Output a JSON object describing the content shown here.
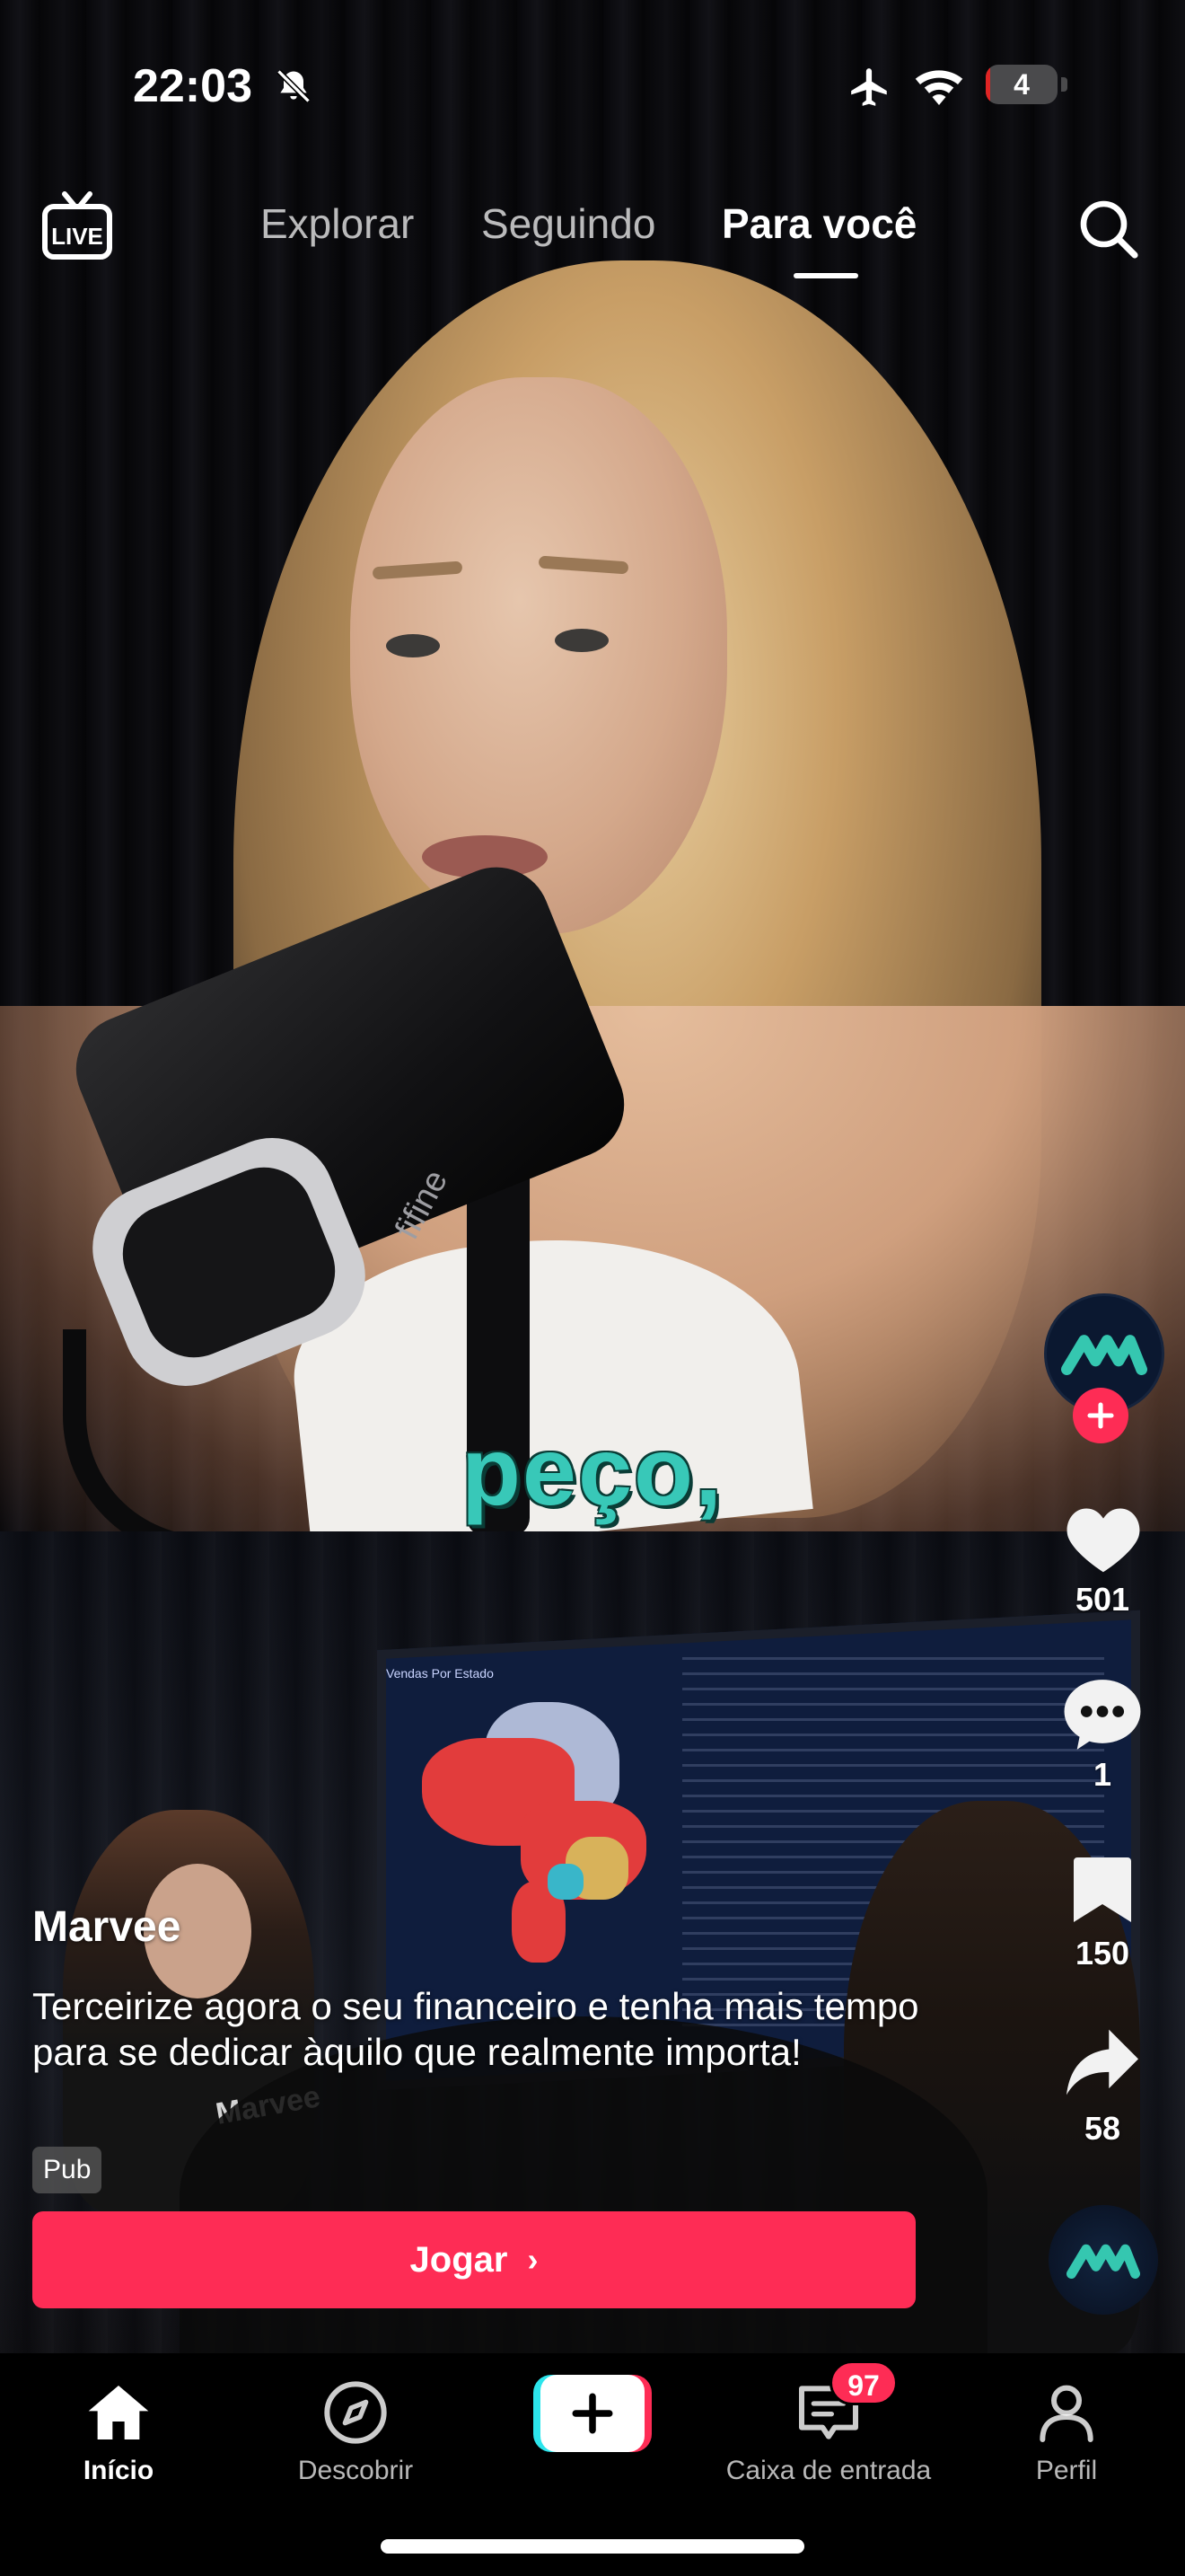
{
  "status_bar": {
    "time": "22:03",
    "battery_level": "4",
    "battery_fraction": 0.04,
    "icons": [
      "bell-slash-icon",
      "airplane-icon",
      "wifi-icon",
      "battery-icon"
    ]
  },
  "top_nav": {
    "live_label": "LIVE",
    "tabs": [
      {
        "label": "Explorar",
        "active": false
      },
      {
        "label": "Seguindo",
        "active": false
      },
      {
        "label": "Para você",
        "active": true
      }
    ]
  },
  "video": {
    "caption": "peço,",
    "mic_brand": "fifine",
    "monitor_title": "Vendas Por Estado",
    "shirt_brand": "Marvee"
  },
  "actions": {
    "likes": "501",
    "comments": "1",
    "saves": "150",
    "shares": "58"
  },
  "ad": {
    "account_name": "Marvee",
    "description": "Terceirize agora o seu financeiro e tenha mais tempo para se dedicar àquilo que realmente importa!",
    "tag": "Pub",
    "cta_label": "Jogar",
    "cta_chevron": "›"
  },
  "bottom_nav": {
    "items": [
      {
        "label": "Início",
        "active": true
      },
      {
        "label": "Descobrir",
        "active": false
      },
      {
        "label": "Caixa de entrada",
        "active": false,
        "badge": "97"
      },
      {
        "label": "Perfil",
        "active": false
      }
    ]
  },
  "colors": {
    "accent": "#fe2c55",
    "create_cyan": "#2ce5ec",
    "caption_teal": "#38c8b8",
    "brand_teal": "#35c7b0"
  }
}
